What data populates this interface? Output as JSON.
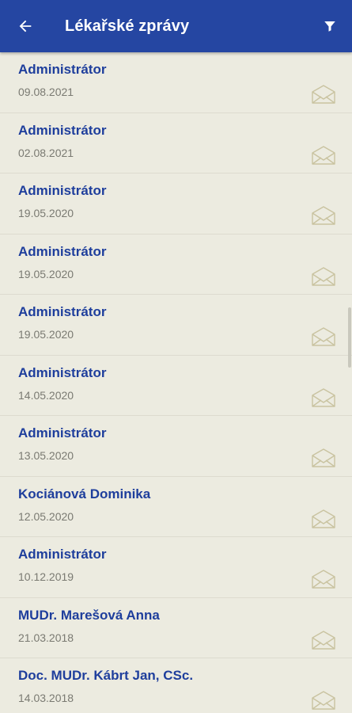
{
  "header": {
    "title": "Lékařské zprávy",
    "back_icon": "arrow-left-icon",
    "filter_icon": "filter-icon",
    "background": "#2546a2"
  },
  "messages": [
    {
      "sender": "Administrátor",
      "date": "09.08.2021"
    },
    {
      "sender": "Administrátor",
      "date": "02.08.2021"
    },
    {
      "sender": "Administrátor",
      "date": "19.05.2020"
    },
    {
      "sender": "Administrátor",
      "date": "19.05.2020"
    },
    {
      "sender": "Administrátor",
      "date": "19.05.2020"
    },
    {
      "sender": "Administrátor",
      "date": "14.05.2020"
    },
    {
      "sender": "Administrátor",
      "date": "13.05.2020"
    },
    {
      "sender": "Kociánová Dominika",
      "date": "12.05.2020"
    },
    {
      "sender": "Administrátor",
      "date": "10.12.2019"
    },
    {
      "sender": "MUDr. Marešová Anna",
      "date": "21.03.2018"
    },
    {
      "sender": "Doc. MUDr. Kábrt Jan, CSc.",
      "date": "14.03.2018"
    }
  ],
  "colors": {
    "accent": "#1e3e9c",
    "background": "#ecebe0",
    "date_text": "#7a7a72",
    "envelope_icon": "#c9c3a0"
  },
  "row_icon": "open-envelope-icon"
}
